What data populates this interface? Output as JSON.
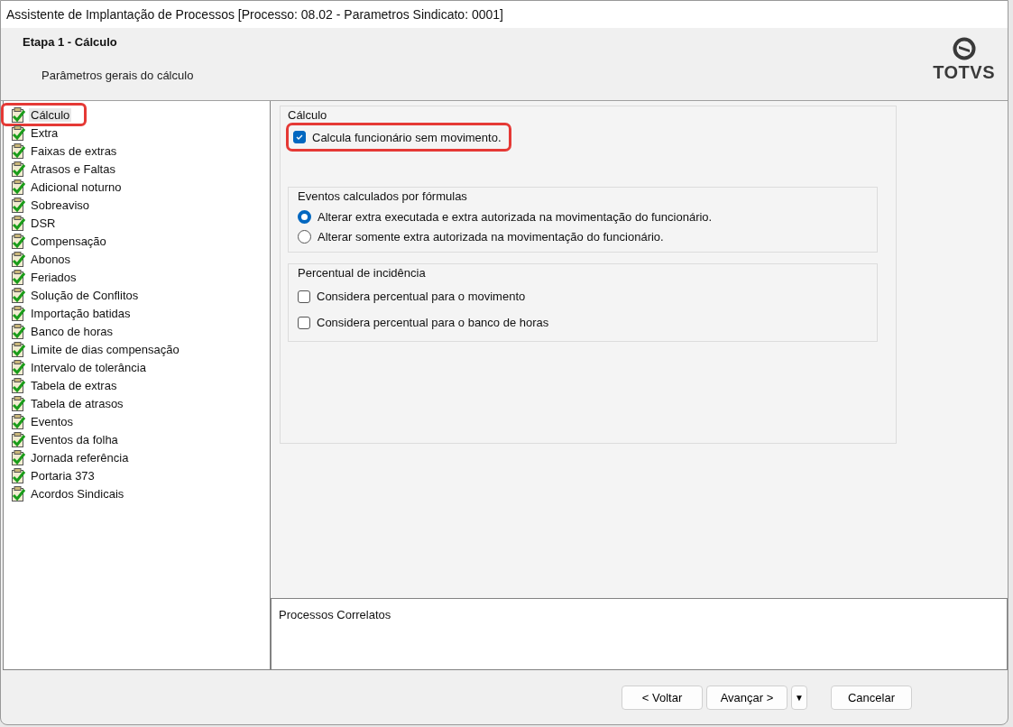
{
  "window": {
    "title": "Assistente de Implantação de Processos [Processo: 08.02 - Parametros Sindicato: 0001]"
  },
  "header": {
    "step": "Etapa 1 - Cálculo",
    "description": "Parâmetros gerais do cálculo",
    "logo": "TOTVS"
  },
  "steps": [
    {
      "label": "Cálculo",
      "selected": true,
      "highlighted": true
    },
    {
      "label": "Extra",
      "selected": false,
      "highlighted": false
    },
    {
      "label": "Faixas de extras",
      "selected": false,
      "highlighted": false
    },
    {
      "label": "Atrasos e Faltas",
      "selected": false,
      "highlighted": false
    },
    {
      "label": "Adicional noturno",
      "selected": false,
      "highlighted": false
    },
    {
      "label": "Sobreaviso",
      "selected": false,
      "highlighted": false
    },
    {
      "label": "DSR",
      "selected": false,
      "highlighted": false
    },
    {
      "label": "Compensação",
      "selected": false,
      "highlighted": false
    },
    {
      "label": "Abonos",
      "selected": false,
      "highlighted": false
    },
    {
      "label": "Feriados",
      "selected": false,
      "highlighted": false
    },
    {
      "label": "Solução de Conflitos",
      "selected": false,
      "highlighted": false
    },
    {
      "label": "Importação batidas",
      "selected": false,
      "highlighted": false
    },
    {
      "label": "Banco de horas",
      "selected": false,
      "highlighted": false
    },
    {
      "label": "Limite de dias compensação",
      "selected": false,
      "highlighted": false
    },
    {
      "label": "Intervalo de tolerância",
      "selected": false,
      "highlighted": false
    },
    {
      "label": "Tabela de extras",
      "selected": false,
      "highlighted": false
    },
    {
      "label": "Tabela de atrasos",
      "selected": false,
      "highlighted": false
    },
    {
      "label": "Eventos",
      "selected": false,
      "highlighted": false
    },
    {
      "label": "Eventos da folha",
      "selected": false,
      "highlighted": false
    },
    {
      "label": "Jornada referência",
      "selected": false,
      "highlighted": false
    },
    {
      "label": "Portaria 373",
      "selected": false,
      "highlighted": false
    },
    {
      "label": "Acordos Sindicais",
      "selected": false,
      "highlighted": false
    }
  ],
  "group": {
    "title": "Cálculo",
    "options": [
      {
        "label": "Calcula funcionário sem movimento.",
        "checked": true,
        "highlighted": true
      }
    ],
    "subgroups": [
      {
        "title": "Eventos calculados por fórmulas",
        "kind": "radio",
        "options": [
          {
            "label": "Alterar extra executada e extra autorizada na movimentação do funcionário.",
            "selected": true
          },
          {
            "label": "Alterar somente extra autorizada na movimentação do funcionário.",
            "selected": false
          }
        ]
      },
      {
        "title": "Percentual de incidência",
        "kind": "checkbox",
        "options": [
          {
            "label": "Considera percentual para o movimento",
            "checked": false
          },
          {
            "label": "Considera percentual para o banco de horas",
            "checked": false
          }
        ]
      }
    ]
  },
  "related": {
    "title": "Processos Correlatos"
  },
  "buttons": [
    {
      "label": "< Voltar",
      "kind": "button"
    },
    {
      "label": "Avançar >",
      "kind": "button"
    },
    {
      "label": "▼",
      "kind": "dropdown"
    },
    {
      "label": "Cancelar",
      "kind": "button"
    }
  ]
}
